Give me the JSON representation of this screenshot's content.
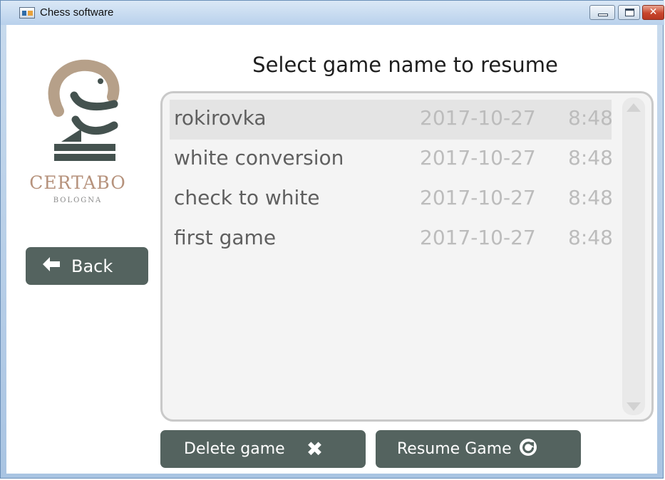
{
  "window": {
    "title": "Chess software",
    "icons": {
      "app": "app-window-icon",
      "minimize": "minimize-icon",
      "maximize": "maximize-icon",
      "close": "close-icon"
    }
  },
  "logo": {
    "brand": "CERTABO",
    "city": "BOLOGNA",
    "icon": "knight-logo-icon"
  },
  "back_button": {
    "label": "Back",
    "icon": "arrow-left-icon"
  },
  "heading": "Select game name to resume",
  "games": [
    {
      "name": "rokirovka",
      "date": "2017-10-27",
      "time": "8:48",
      "selected": true
    },
    {
      "name": "white conversion",
      "date": "2017-10-27",
      "time": "8:48",
      "selected": false
    },
    {
      "name": "check to white",
      "date": "2017-10-27",
      "time": "8:48",
      "selected": false
    },
    {
      "name": "first game",
      "date": "2017-10-27",
      "time": "8:48",
      "selected": false
    }
  ],
  "actions": {
    "delete_label": "Delete game",
    "delete_icon": "x-icon",
    "resume_label": "Resume Game",
    "resume_icon": "refresh-icon"
  },
  "colors": {
    "button_bg": "#54635f",
    "brand_text": "#b6927c",
    "logo_dark": "#44524f",
    "logo_tan": "#b6a089",
    "close_button": "#c8452c",
    "selected_row": "#e4e4e4"
  }
}
